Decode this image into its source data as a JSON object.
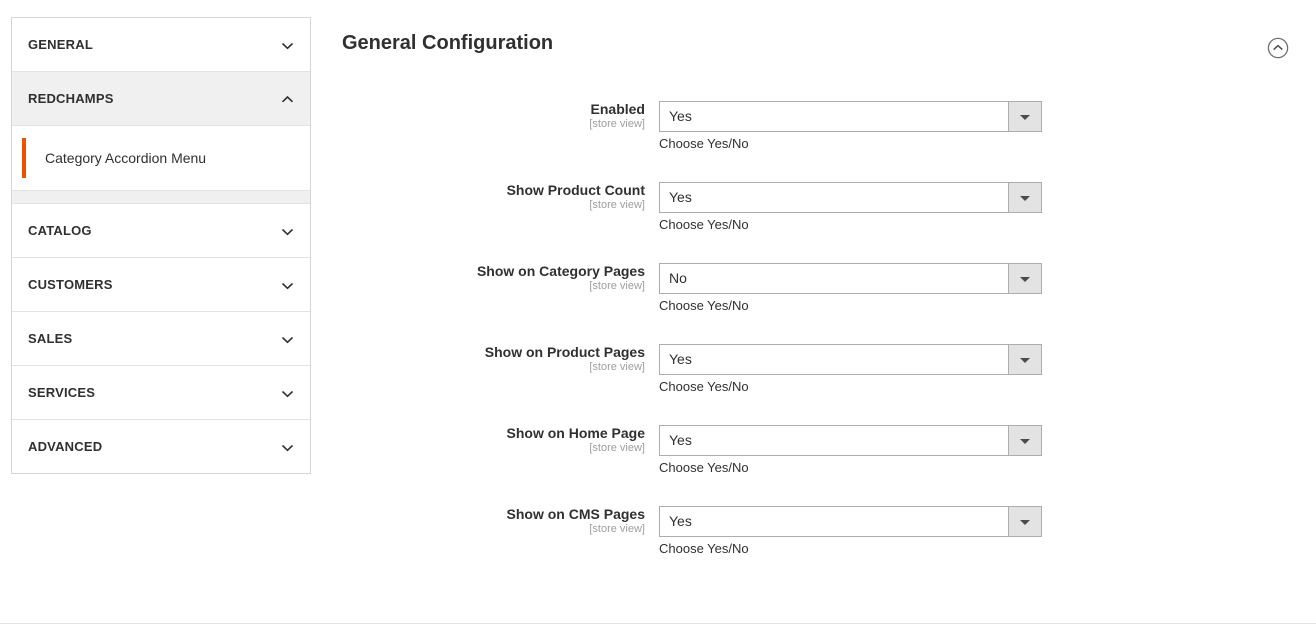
{
  "sidebar": {
    "sections": [
      {
        "title": "GENERAL",
        "expanded": false,
        "icon": "chevron-down-icon"
      },
      {
        "title": "REDCHAMPS",
        "expanded": true,
        "icon": "chevron-up-icon",
        "items": [
          {
            "label": "Category Accordion Menu",
            "active": true
          }
        ]
      },
      {
        "title": "CATALOG",
        "expanded": false,
        "icon": "chevron-down-icon"
      },
      {
        "title": "CUSTOMERS",
        "expanded": false,
        "icon": "chevron-down-icon"
      },
      {
        "title": "SALES",
        "expanded": false,
        "icon": "chevron-down-icon"
      },
      {
        "title": "SERVICES",
        "expanded": false,
        "icon": "chevron-down-icon"
      },
      {
        "title": "ADVANCED",
        "expanded": false,
        "icon": "chevron-down-icon"
      }
    ]
  },
  "main": {
    "section_title": "General Configuration",
    "collapse_icon": "circle-chevron-up-icon",
    "scope_label": "[store view]",
    "fields": [
      {
        "label": "Enabled",
        "scope": "[store view]",
        "value": "Yes",
        "note": "Choose Yes/No"
      },
      {
        "label": "Show Product Count",
        "scope": "[store view]",
        "value": "Yes",
        "note": "Choose Yes/No"
      },
      {
        "label": "Show on Category Pages",
        "scope": "[store view]",
        "value": "No",
        "note": "Choose Yes/No"
      },
      {
        "label": "Show on Product Pages",
        "scope": "[store view]",
        "value": "Yes",
        "note": "Choose Yes/No"
      },
      {
        "label": "Show on Home Page",
        "scope": "[store view]",
        "value": "Yes",
        "note": "Choose Yes/No"
      },
      {
        "label": "Show on CMS Pages",
        "scope": "[store view]",
        "value": "Yes",
        "note": "Choose Yes/No"
      }
    ],
    "select_options": [
      "Yes",
      "No"
    ]
  },
  "colors": {
    "accent": "#eb5202",
    "text": "#303030",
    "muted": "#9e9e9e",
    "panel_open_bg": "#f0f0f0",
    "border": "#d6d6d6",
    "select_border": "#adadad",
    "select_button_bg": "#e3e3e3"
  }
}
